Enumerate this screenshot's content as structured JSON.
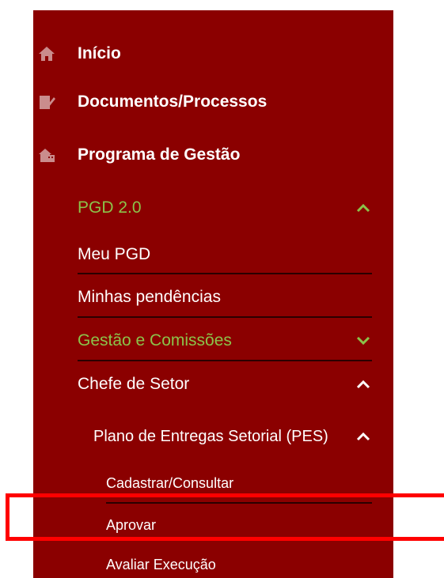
{
  "menu": {
    "inicio": "Início",
    "documentos": "Documentos/Processos",
    "programa": "Programa de Gestão",
    "pgd": "PGD 2.0",
    "meu_pgd": "Meu PGD",
    "pendencias": "Minhas pendências",
    "gestao": "Gestão e Comissões",
    "chefe": "Chefe de Setor",
    "plano": "Plano de Entregas Setorial (PES)",
    "cadastrar": "Cadastrar/Consultar",
    "aprovar": "Aprovar",
    "avaliar": "Avaliar Execução"
  },
  "colors": {
    "sidebar_bg": "#8b0000",
    "active_text": "#8bc34a",
    "highlight": "#ff0000"
  },
  "icons": {
    "inicio": "home-icon",
    "documentos": "edit-document-icon",
    "programa": "building-icon"
  }
}
